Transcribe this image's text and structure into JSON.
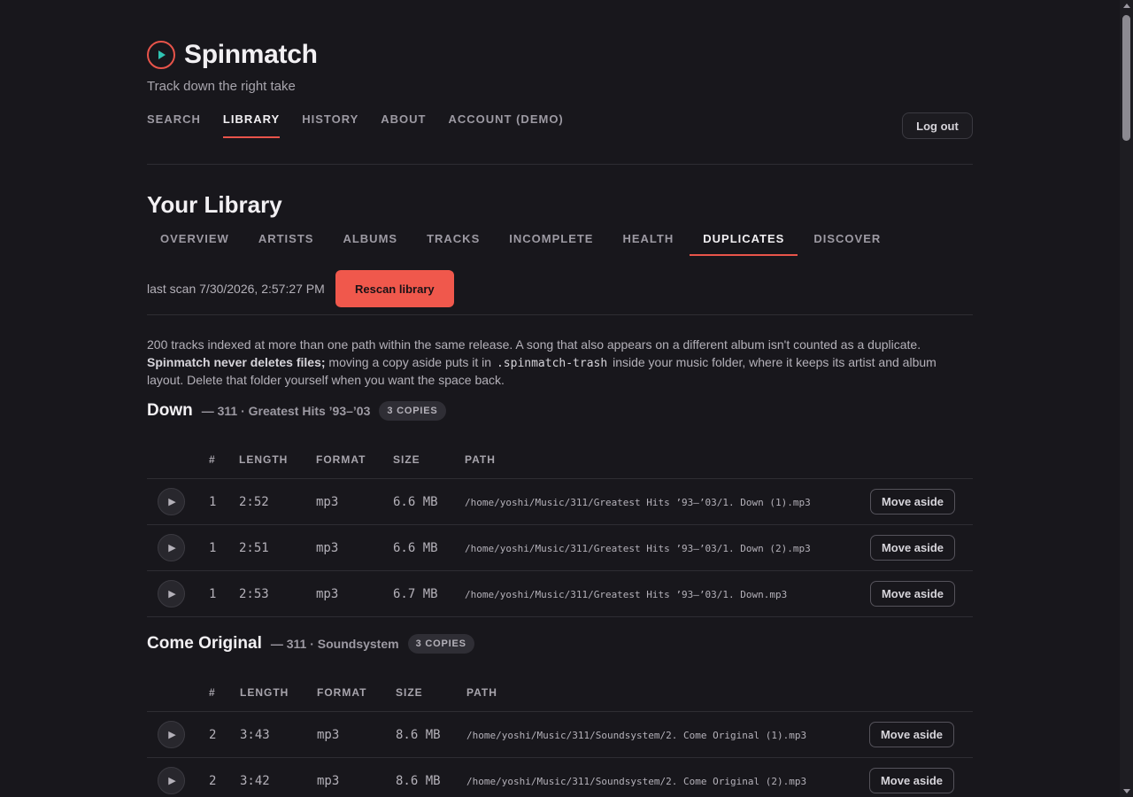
{
  "brand": {
    "name": "Spinmatch",
    "tagline": "Track down the right take"
  },
  "colors": {
    "accent": "#f0584c",
    "background": "#18171c"
  },
  "mainnav": [
    {
      "label": "SEARCH",
      "active": false
    },
    {
      "label": "LIBRARY",
      "active": true
    },
    {
      "label": "HISTORY",
      "active": false
    },
    {
      "label": "ABOUT",
      "active": false
    },
    {
      "label": "ACCOUNT (DEMO)",
      "active": false
    }
  ],
  "header": {
    "logout_label": "Log out"
  },
  "library": {
    "title": "Your Library",
    "tabs": [
      {
        "label": "OVERVIEW",
        "active": false
      },
      {
        "label": "ARTISTS",
        "active": false
      },
      {
        "label": "ALBUMS",
        "active": false
      },
      {
        "label": "TRACKS",
        "active": false
      },
      {
        "label": "INCOMPLETE",
        "active": false
      },
      {
        "label": "HEALTH",
        "active": false
      },
      {
        "label": "DUPLICATES",
        "active": true
      },
      {
        "label": "DISCOVER",
        "active": false
      }
    ],
    "last_scan": "last scan 7/30/2026, 2:57:27 PM",
    "rescan_label": "Rescan library",
    "description": {
      "line1": "200 tracks indexed at more than one path within the same release. A song that also appears on a different album isn't counted as a duplicate.",
      "bold": "Spinmatch never deletes files;",
      "part2": " moving a copy aside puts it in ",
      "code": ".spinmatch-trash",
      "part3": " inside your music folder, where it keeps its artist and album layout. Delete that folder yourself when you want the space back."
    }
  },
  "table_headers": {
    "num": "#",
    "length": "LENGTH",
    "format": "FORMAT",
    "size": "SIZE",
    "path": "PATH"
  },
  "groups": [
    {
      "title": "Down",
      "subtitle": "— 311 · Greatest Hits ’93–’03",
      "badge": "3 COPIES",
      "rows": [
        {
          "num": "1",
          "length": "2:52",
          "format": "mp3",
          "size": "6.6 MB",
          "path": "/home/yoshi/Music/311/Greatest Hits ’93–’03/1. Down (1).mp3",
          "action": "Move aside"
        },
        {
          "num": "1",
          "length": "2:51",
          "format": "mp3",
          "size": "6.6 MB",
          "path": "/home/yoshi/Music/311/Greatest Hits ’93–’03/1. Down (2).mp3",
          "action": "Move aside"
        },
        {
          "num": "1",
          "length": "2:53",
          "format": "mp3",
          "size": "6.7 MB",
          "path": "/home/yoshi/Music/311/Greatest Hits ’93–’03/1. Down.mp3",
          "action": "Move aside"
        }
      ]
    },
    {
      "title": "Come Original",
      "subtitle": "— 311 · Soundsystem",
      "badge": "3 COPIES",
      "rows": [
        {
          "num": "2",
          "length": "3:43",
          "format": "mp3",
          "size": "8.6 MB",
          "path": "/home/yoshi/Music/311/Soundsystem/2. Come Original (1).mp3",
          "action": "Move aside"
        },
        {
          "num": "2",
          "length": "3:42",
          "format": "mp3",
          "size": "8.6 MB",
          "path": "/home/yoshi/Music/311/Soundsystem/2. Come Original (2).mp3",
          "action": "Move aside"
        }
      ]
    }
  ],
  "icons": {
    "logo": "play-circle-icon",
    "row_play": "play-icon"
  }
}
